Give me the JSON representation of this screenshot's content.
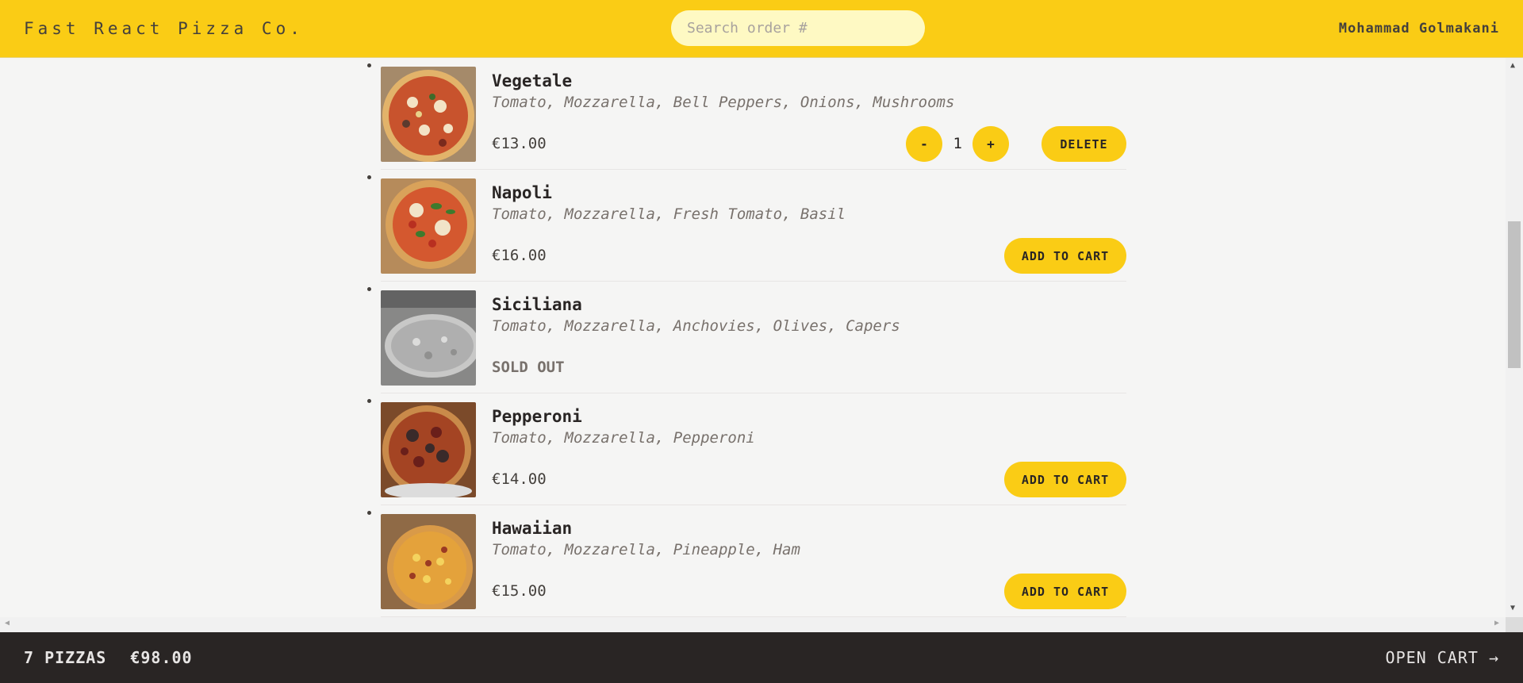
{
  "header": {
    "logo": "Fast React Pizza Co.",
    "search_placeholder": "Search order #",
    "username": "Mohammad Golmakani"
  },
  "menu": [
    {
      "name": "Vegetale",
      "ingredients": "Tomato, Mozzarella, Bell Peppers, Onions, Mushrooms",
      "price": "€13.00",
      "in_cart": true,
      "quantity": "1",
      "decrease_label": "-",
      "increase_label": "+",
      "delete_label": "Delete"
    },
    {
      "name": "Napoli",
      "ingredients": "Tomato, Mozzarella, Fresh Tomato, Basil",
      "price": "€16.00",
      "add_label": "Add to cart"
    },
    {
      "name": "Siciliana",
      "ingredients": "Tomato, Mozzarella, Anchovies, Olives, Capers",
      "sold_out_label": "Sold out"
    },
    {
      "name": "Pepperoni",
      "ingredients": "Tomato, Mozzarella, Pepperoni",
      "price": "€14.00",
      "add_label": "Add to cart"
    },
    {
      "name": "Hawaiian",
      "ingredients": "Tomato, Mozzarella, Pineapple, Ham",
      "price": "€15.00",
      "add_label": "Add to cart"
    }
  ],
  "cart": {
    "count": "7 pizzas",
    "total": "€98.00",
    "open_label": "Open cart →"
  },
  "colors": {
    "brand_yellow": "#facc15",
    "footer_dark": "#292524",
    "background": "#f5f5f4"
  }
}
